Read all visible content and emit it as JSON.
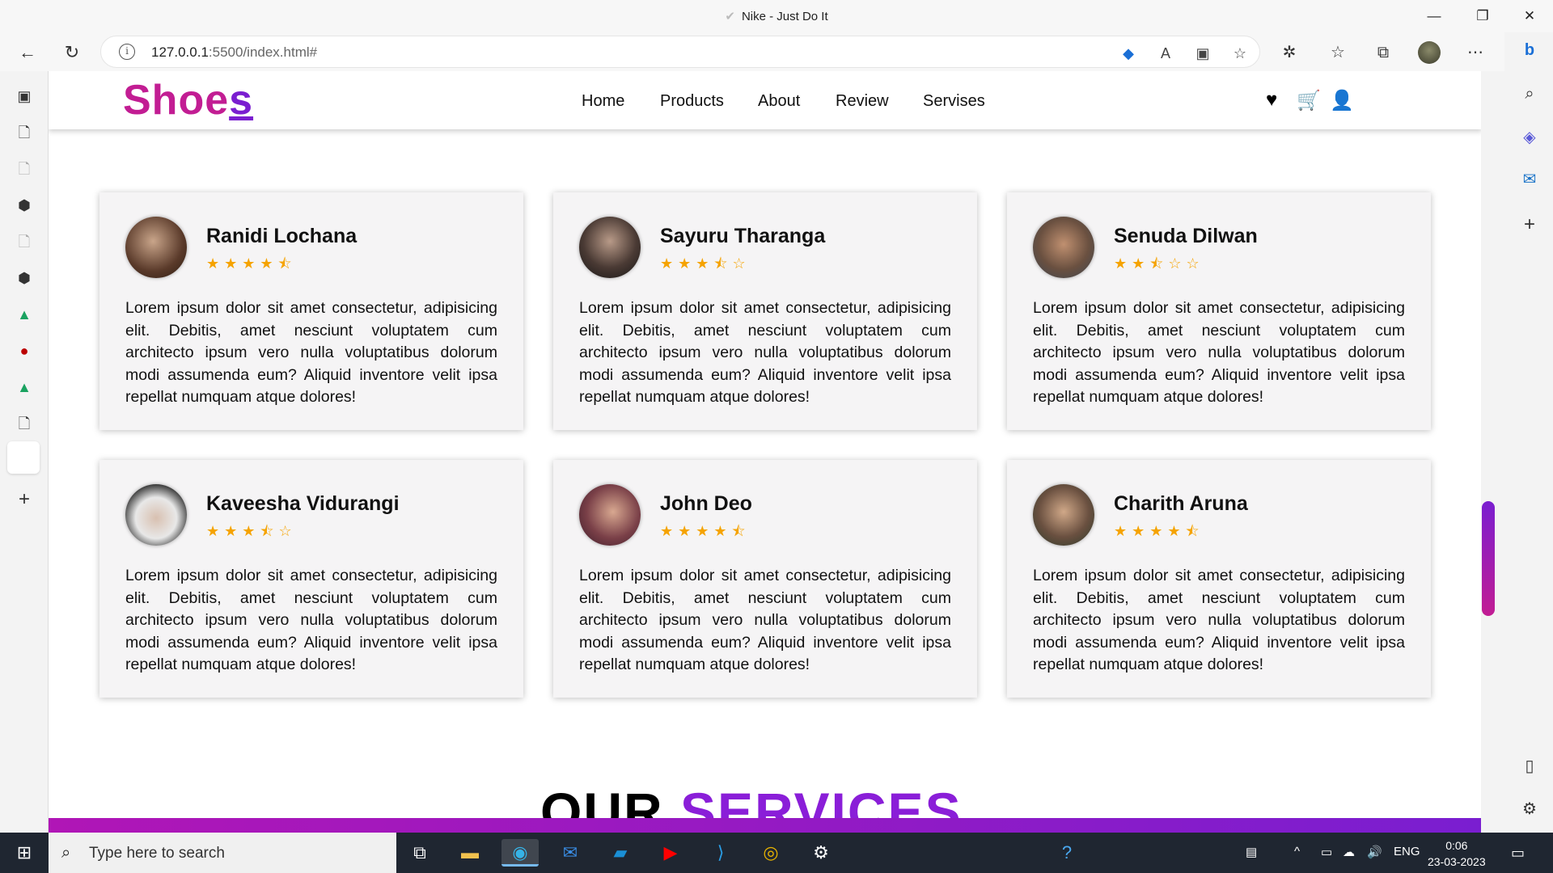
{
  "window": {
    "title": "Nike - Just Do It",
    "controls": {
      "minimize": "—",
      "restore": "❐",
      "close": "✕"
    }
  },
  "browser": {
    "url_host": "127.0.0.1",
    "url_rest": ":5500/index.html#",
    "icons": [
      "back-icon",
      "refresh-icon",
      "info-icon",
      "tag-icon",
      "read-aloud-icon",
      "immersive-reader-icon",
      "add-favorite-icon",
      "extensions-icon",
      "favorites-icon",
      "collections-icon",
      "profile-avatar",
      "more-icon"
    ]
  },
  "site": {
    "logo_main": "Shoe",
    "logo_last": "s",
    "nav": [
      "Home",
      "Products",
      "About",
      "Review",
      "Servises"
    ],
    "header_icons": [
      "heart-icon",
      "cart-icon",
      "user-icon"
    ]
  },
  "reviews": [
    {
      "name": "Ranidi Lochana",
      "stars": "★★★★⯪",
      "rating": 4.5,
      "text": "Lorem ipsum dolor sit amet consectetur, adipisicing elit. Debitis, amet nesciunt voluptatem cum architecto ipsum vero nulla voluptatibus dolorum modi assumenda eum? Aliquid inventore velit ipsa repellat numquam atque dolores!"
    },
    {
      "name": "Sayuru Tharanga",
      "stars": "★★★⯪☆",
      "rating": 3.5,
      "text": "Lorem ipsum dolor sit amet consectetur, adipisicing elit. Debitis, amet nesciunt voluptatem cum architecto ipsum vero nulla voluptatibus dolorum modi assumenda eum? Aliquid inventore velit ipsa repellat numquam atque dolores!"
    },
    {
      "name": "Senuda Dilwan",
      "stars": "★★⯪☆☆",
      "rating": 2.5,
      "text": "Lorem ipsum dolor sit amet consectetur, adipisicing elit. Debitis, amet nesciunt voluptatem cum architecto ipsum vero nulla voluptatibus dolorum modi assumenda eum? Aliquid inventore velit ipsa repellat numquam atque dolores!"
    },
    {
      "name": "Kaveesha Vidurangi",
      "stars": "★★★⯪☆",
      "rating": 3.5,
      "text": "Lorem ipsum dolor sit amet consectetur, adipisicing elit. Debitis, amet nesciunt voluptatem cum architecto ipsum vero nulla voluptatibus dolorum modi assumenda eum? Aliquid inventore velit ipsa repellat numquam atque dolores!"
    },
    {
      "name": "John Deo",
      "stars": "★★★★⯪",
      "rating": 4.5,
      "text": "Lorem ipsum dolor sit amet consectetur, adipisicing elit. Debitis, amet nesciunt voluptatem cum architecto ipsum vero nulla voluptatibus dolorum modi assumenda eum? Aliquid inventore velit ipsa repellat numquam atque dolores!"
    },
    {
      "name": "Charith Aruna",
      "stars": "★★★★⯪",
      "rating": 4.5,
      "text": "Lorem ipsum dolor sit amet consectetur, adipisicing elit. Debitis, amet nesciunt voluptatem cum architecto ipsum vero nulla voluptatibus dolorum modi assumenda eum? Aliquid inventore velit ipsa repellat numquam atque dolores!"
    }
  ],
  "services": {
    "word1": "OUR",
    "word2": "SERVICES"
  },
  "taskbar": {
    "search_placeholder": "Type here to search",
    "language": "ENG",
    "time": "0:06",
    "date": "23-03-2023"
  },
  "colors": {
    "brand_pink": "#c21d93",
    "brand_purple": "#7a1ed0",
    "star": "#f5a300"
  }
}
